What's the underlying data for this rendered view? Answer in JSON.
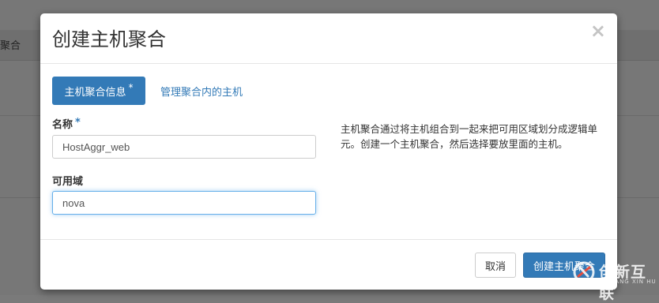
{
  "background": {
    "column_header_fragment": "聚合"
  },
  "modal": {
    "title": "创建主机聚合",
    "close_symbol": "×",
    "tabs": [
      {
        "label": "主机聚合信息",
        "required_marker": "*",
        "active": true
      },
      {
        "label": "管理聚合内的主机",
        "active": false
      }
    ],
    "fields": {
      "name": {
        "label": "名称",
        "required_marker": "*",
        "value": "HostAggr_web"
      },
      "availability_zone": {
        "label": "可用域",
        "value": "nova"
      }
    },
    "help_text": "主机聚合通过将主机组合到一起来把可用区域划分成逻辑单元。创建一个主机聚合，然后选择要放里面的主机。",
    "buttons": {
      "cancel": "取消",
      "submit": "创建主机聚合"
    }
  },
  "watermark": {
    "text": "创新互联",
    "subtext": "CHUANG XIN HU LIAN"
  },
  "colors": {
    "primary": "#337ab7",
    "focus": "#66afe9",
    "backdrop": "#777777"
  }
}
